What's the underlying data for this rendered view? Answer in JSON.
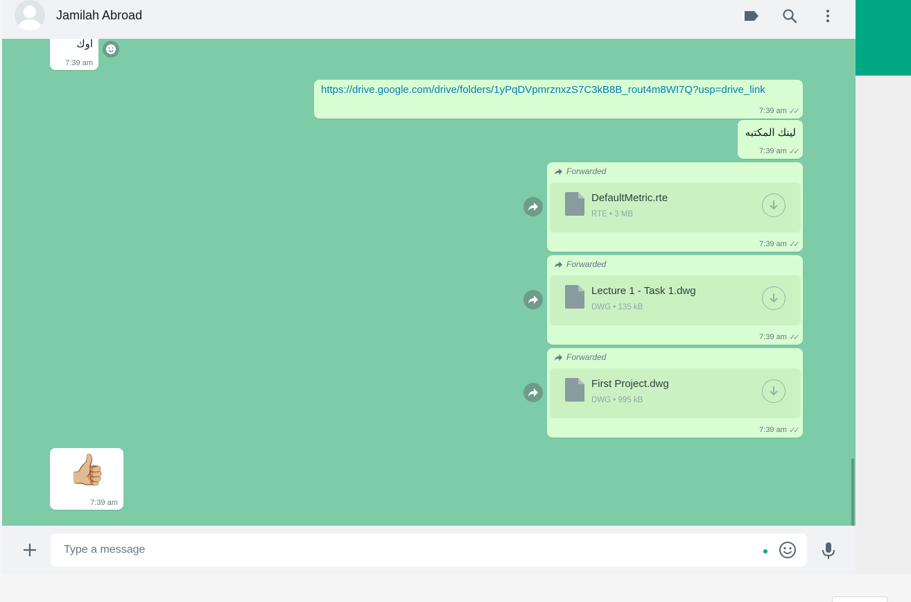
{
  "header": {
    "contact_name": "Jamilah Abroad"
  },
  "messages": {
    "m1": {
      "text": "اوك",
      "time": "7:39 am"
    },
    "m2": {
      "link": "https://drive.google.com/drive/folders/1yPqDVpmrznxzS7C3kB8B_rout4m8WI7Q?usp=drive_link",
      "time": "7:39 am"
    },
    "m3": {
      "text": "لينك المكتبه",
      "time": "7:39 am"
    },
    "m4": {
      "forwarded_label": "Forwarded",
      "file_name": "DefaultMetric.rte",
      "file_type": "RTE",
      "file_size": "3 MB",
      "time": "7:39 am"
    },
    "m5": {
      "forwarded_label": "Forwarded",
      "file_name": "Lecture 1 - Task 1.dwg",
      "file_type": "DWG",
      "file_size": "135 kB",
      "time": "7:39 am"
    },
    "m6": {
      "forwarded_label": "Forwarded",
      "file_name": "First Project.dwg",
      "file_type": "DWG",
      "file_size": "995 kB",
      "time": "7:39 am"
    },
    "m7": {
      "emoji": "👍🏼",
      "time": "7:39 am"
    }
  },
  "composer": {
    "placeholder": "Type a message"
  },
  "icons": [
    "avatar",
    "label-icon",
    "search-icon",
    "menu-dots-icon",
    "emoji-reaction-icon",
    "forward-icon",
    "document-icon",
    "download-icon",
    "plus-icon",
    "emoji-icon",
    "mic-icon",
    "double-check-icon"
  ],
  "colors": {
    "chat_bg": "#7ecba7",
    "outgoing_bubble": "#d9fdd3",
    "incoming_bubble": "#ffffff",
    "accent": "#00a884",
    "link": "#027eb5"
  }
}
